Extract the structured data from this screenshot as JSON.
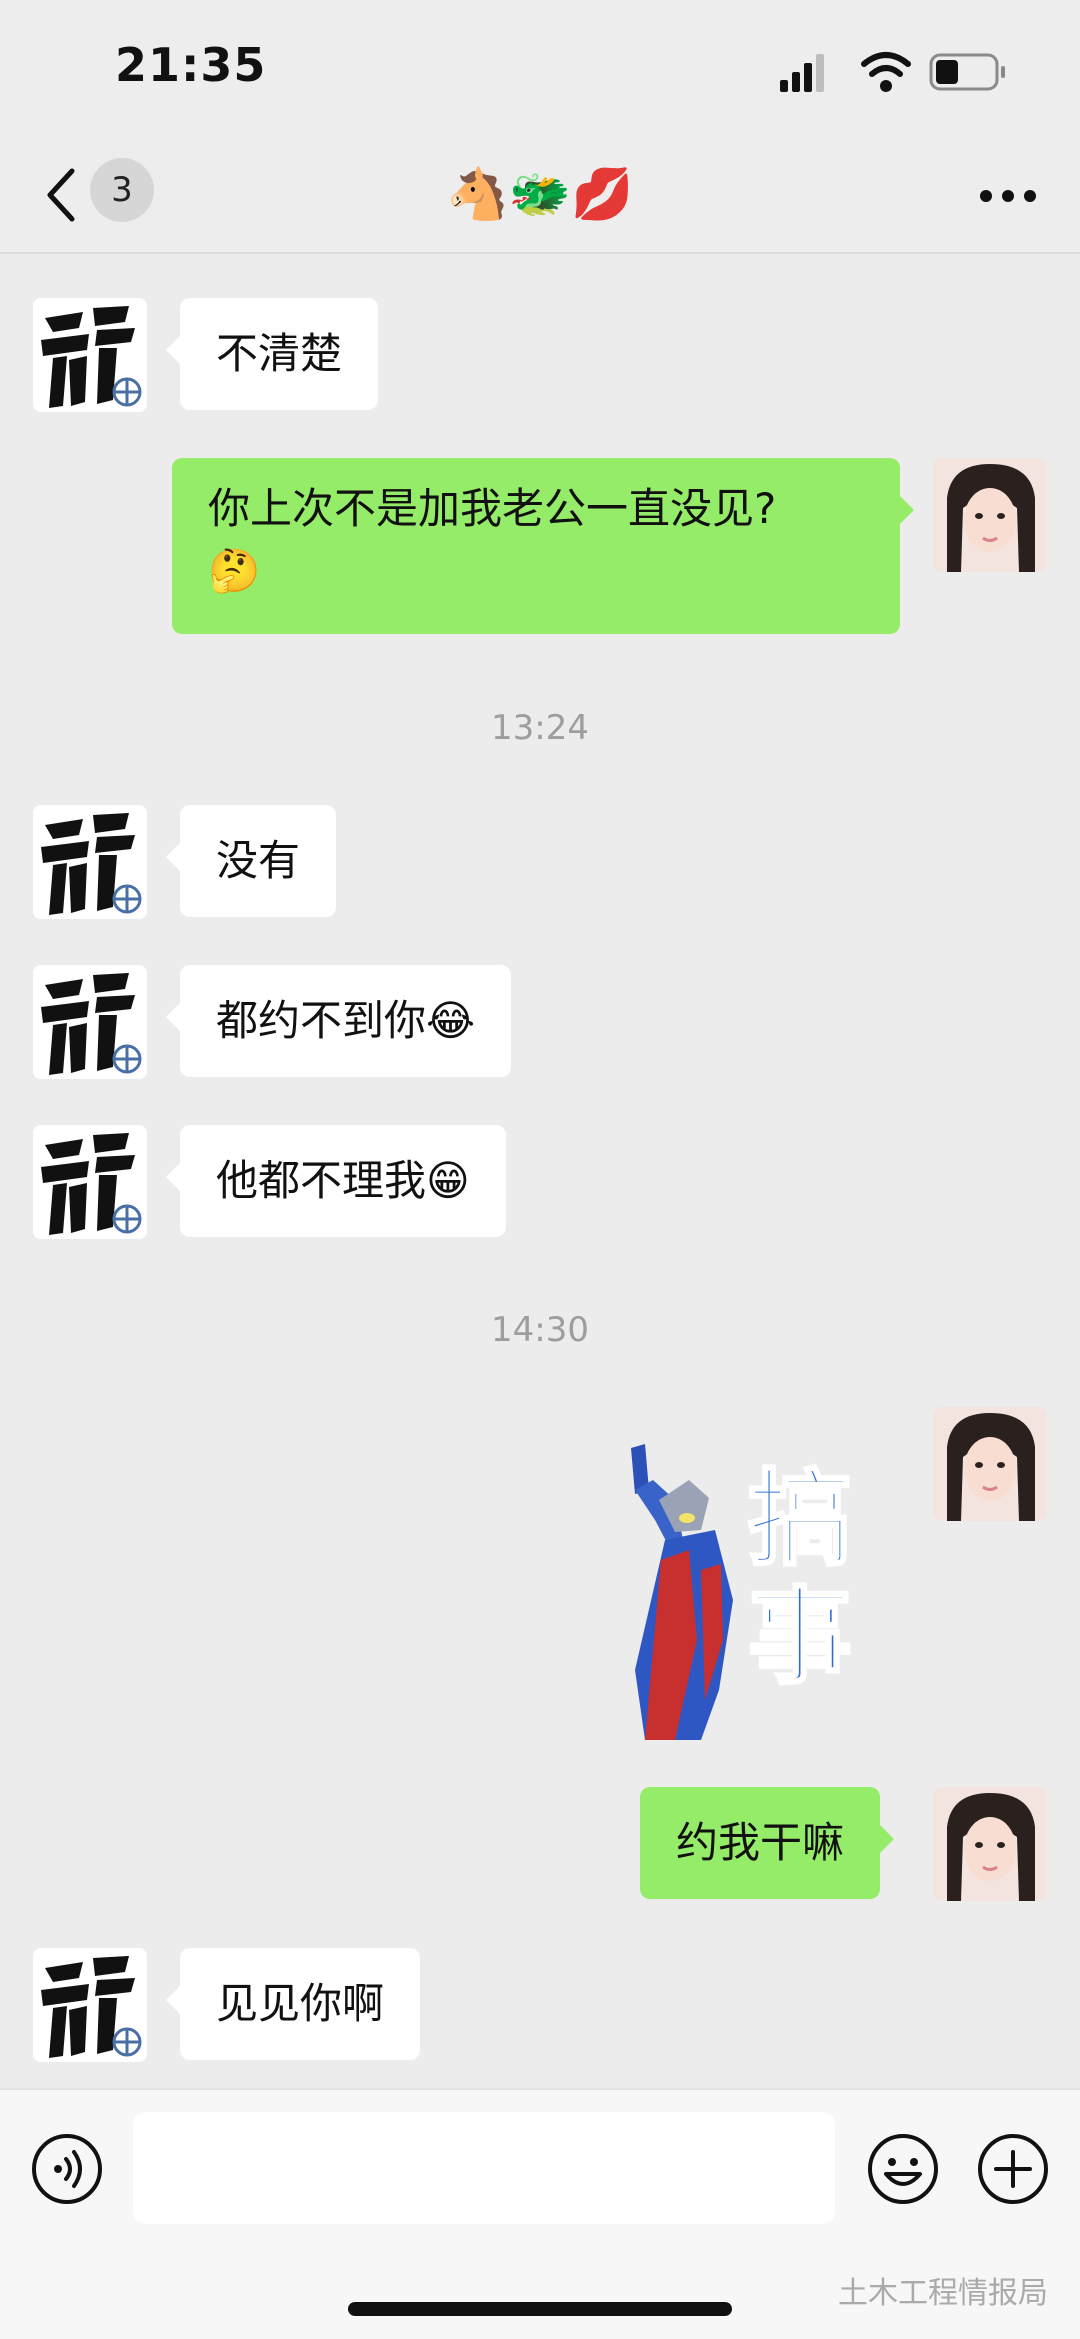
{
  "status_bar": {
    "time": "21:35"
  },
  "nav": {
    "unread_count": "3",
    "title": "🐴🐲💋"
  },
  "messages": [
    {
      "from": "contact",
      "text": "不清楚"
    },
    {
      "from": "me",
      "line1": "你上次不是加我老公一直没见?",
      "line2": "🤔"
    },
    {
      "timestamp": "13:24"
    },
    {
      "from": "contact",
      "text": "没有"
    },
    {
      "from": "contact",
      "text": "都约不到你😂"
    },
    {
      "from": "contact",
      "text": "他都不理我😁"
    },
    {
      "timestamp": "14:30"
    },
    {
      "from": "me",
      "type": "sticker",
      "sticker_text": "搞事"
    },
    {
      "from": "me",
      "text": "约我干嘛"
    },
    {
      "from": "contact",
      "text": "见见你啊"
    }
  ],
  "watermark": "土木工程情报局",
  "colors": {
    "sent_bubble": "#95ec69",
    "received_bubble": "#ffffff",
    "background": "#ececec"
  },
  "icons": [
    "back-chevron-icon",
    "more-dots-icon",
    "signal-icon",
    "wifi-icon",
    "battery-icon",
    "voice-icon",
    "emoji-icon",
    "add-icon"
  ]
}
